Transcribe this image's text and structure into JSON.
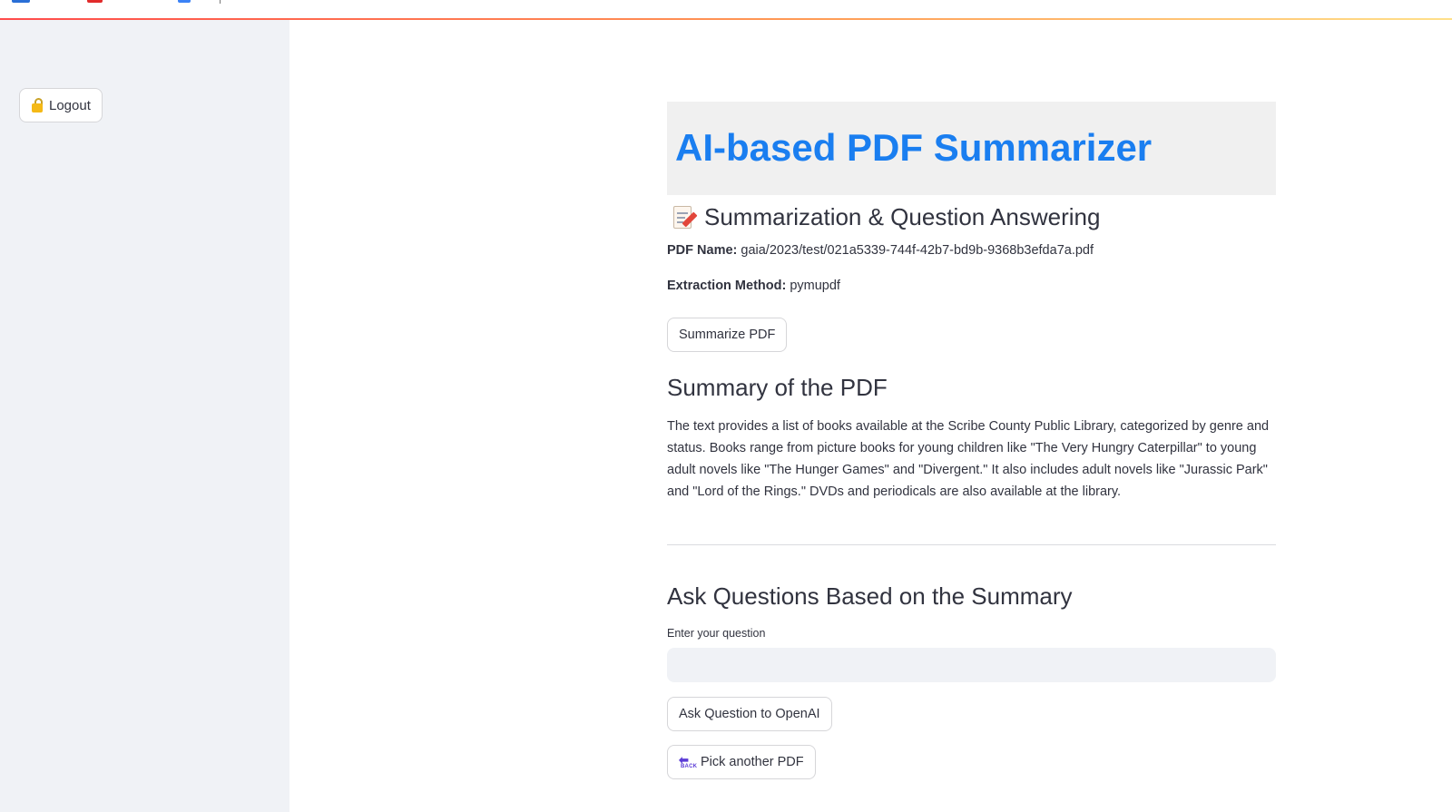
{
  "sidebar": {
    "logout_label": "Logout",
    "logout_icon": "unlocked-padlock-icon"
  },
  "main": {
    "title": "AI-based PDF Summarizer",
    "subheader": "Summarization & Question Answering",
    "subheader_icon": "memo-icon",
    "pdf_name_label": "PDF Name:",
    "pdf_name_value": "gaia/2023/test/021a5339-744f-42b7-bd9b-9368b3efda7a.pdf",
    "extraction_label": "Extraction Method:",
    "extraction_value": "pymupdf",
    "summarize_button": "Summarize PDF",
    "summary_heading": "Summary of the PDF",
    "summary_text": "The text provides a list of books available at the Scribe County Public Library, categorized by genre and status. Books range from picture books for young children like \"The Very Hungry Caterpillar\" to young adult novels like \"The Hunger Games\" and \"Divergent.\" It also includes adult novels like \"Jurassic Park\" and \"Lord of the Rings.\" DVDs and periodicals are also available at the library.",
    "qa_heading": "Ask Questions Based on the Summary",
    "question_label": "Enter your question",
    "question_value": "",
    "ask_button": "Ask Question to OpenAI",
    "pick_button": "Pick another PDF",
    "pick_icon": "back-arrow-icon"
  },
  "colors": {
    "title": "#1a7ef0",
    "sidebar_bg": "#f0f2f6",
    "title_box_bg": "#f0f0f0",
    "decoration_start": "#ff4b4b",
    "decoration_end": "#ffe08a"
  }
}
